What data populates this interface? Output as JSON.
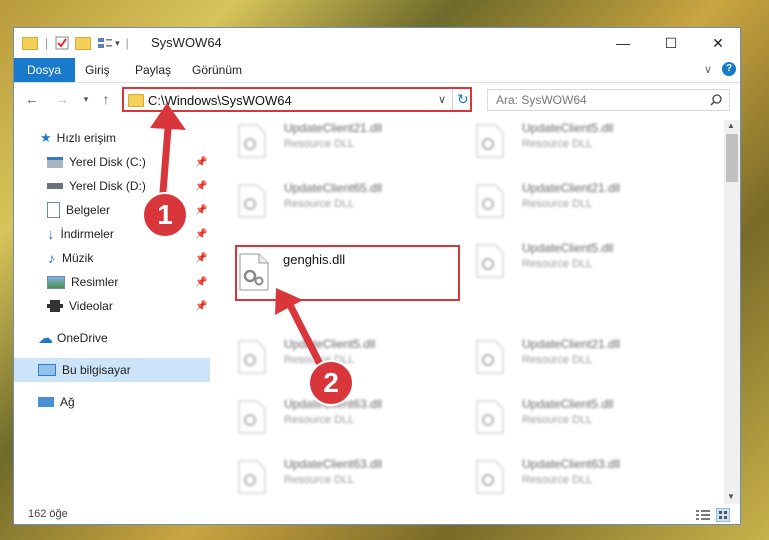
{
  "window": {
    "title": "SysWOW64"
  },
  "ribbon": {
    "tabs": [
      "Dosya",
      "Giriş",
      "Paylaş",
      "Görünüm"
    ]
  },
  "address": {
    "path": "C:\\Windows\\SysWOW64"
  },
  "search": {
    "placeholder": "Ara: SysWOW64"
  },
  "nav": {
    "quick_access": "Hızlı erişim",
    "items": [
      "Yerel Disk (C:)",
      "Yerel Disk (D:)",
      "Belgeler",
      "İndirmeler",
      "Müzik",
      "Resimler",
      "Videolar"
    ],
    "onedrive": "OneDrive",
    "this_pc": "Bu bilgisayar",
    "network": "Ağ"
  },
  "files": {
    "col1": [
      {
        "name": "UpdateClient21.dll",
        "type": "Resource DLL"
      },
      {
        "name": "UpdateClient65.dll",
        "type": "Resource DLL"
      },
      {
        "name": "genghis.dll",
        "type": ""
      },
      {
        "name": "UpdateClient5.dll",
        "type": "Resource DLL"
      },
      {
        "name": "UpdateClient63.dll",
        "type": "Resource DLL"
      },
      {
        "name": "UpdateClient63.dll",
        "type": "Resource DLL"
      }
    ],
    "col2": [
      {
        "name": "UpdateClient5.dll",
        "type": "Resource DLL"
      },
      {
        "name": "UpdateClient21.dll",
        "type": "Resource DLL"
      },
      {
        "name": "UpdateClient5.dll",
        "type": "Resource DLL"
      },
      {
        "name": "UpdateClient21.dll",
        "type": "Resource DLL"
      },
      {
        "name": "UpdateClient5.dll",
        "type": "Resource DLL"
      },
      {
        "name": "UpdateClient63.dll",
        "type": "Resource DLL"
      }
    ]
  },
  "status": {
    "count": "162 öğe"
  },
  "annotations": {
    "step1": "1",
    "step2": "2"
  },
  "colors": {
    "highlight": "#d9363b",
    "accent": "#1979ca"
  }
}
